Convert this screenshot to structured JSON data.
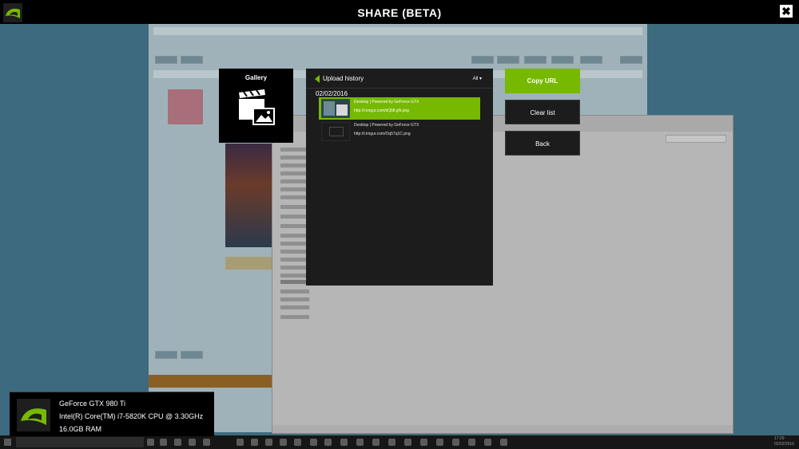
{
  "window": {
    "title": "SHARE (BETA)",
    "close_glyph": "✖"
  },
  "gallery": {
    "label": "Gallery"
  },
  "upload_history": {
    "title": "Upload history",
    "filter": "All",
    "date": "02/02/2016",
    "items": [
      {
        "title": "Desktop | Powered by GeForce GTX",
        "url": "http://i.imgur.com/bQbfl.gN.png",
        "selected": true
      },
      {
        "title": "Desktop | Powered by GeForce GTX",
        "url": "http://i.imgur.com/Oq57q1C.png",
        "selected": false
      }
    ]
  },
  "actions": {
    "copy_url": "Copy URL",
    "clear_list": "Clear list",
    "back": "Back"
  },
  "system_info": {
    "gpu": "GeForce GTX 980 Ti",
    "cpu": "Intel(R) Core(TM) i7-5820K CPU @ 3.30GHz",
    "ram": "16.0GB RAM"
  },
  "taskbar": {
    "time": "17:29",
    "date": "02/02/2016"
  },
  "colors": {
    "accent": "#76b900",
    "panel": "#1c1c1c",
    "bar": "#000000"
  }
}
